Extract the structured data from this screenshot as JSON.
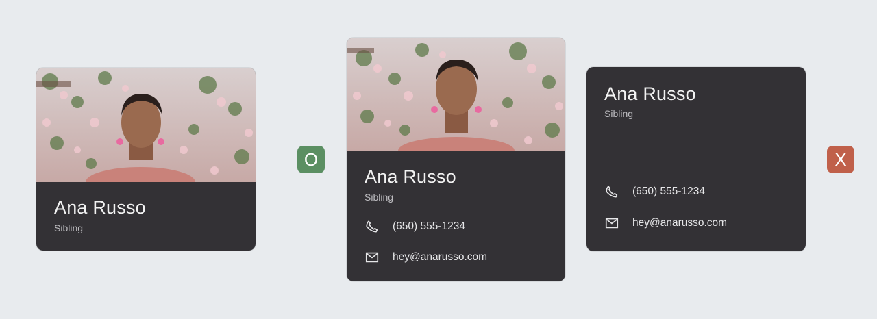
{
  "cards": [
    {
      "name": "Ana Russo",
      "relation": "Sibling"
    },
    {
      "name": "Ana Russo",
      "relation": "Sibling",
      "phone": "(650) 555-1234",
      "email": "hey@anarusso.com",
      "phone_icon": "phone-icon",
      "email_icon": "mail-icon"
    },
    {
      "name": "Ana Russo",
      "relation": "Sibling",
      "phone": "(650) 555-1234",
      "email": "hey@anarusso.com",
      "phone_icon": "phone-icon",
      "email_icon": "mail-icon"
    }
  ],
  "badges": {
    "do": {
      "label": "O",
      "color": "#5b8f62"
    },
    "dont": {
      "label": "X",
      "color": "#c0604a"
    }
  },
  "colors": {
    "background": "#e8ebee",
    "card": "#333135"
  }
}
